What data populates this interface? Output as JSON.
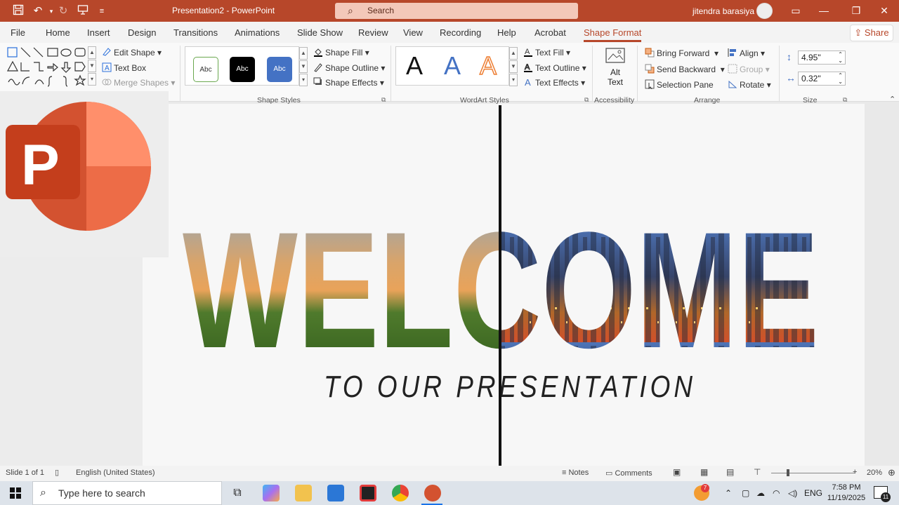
{
  "titlebar": {
    "doc_title": "Presentation2  -  PowerPoint",
    "search_placeholder": "Search",
    "user_name": "jitendra barasiya",
    "qat": {
      "save_icon": "save-icon",
      "undo_icon": "undo-icon",
      "redo_icon": "redo-icon",
      "present_icon": "present-icon",
      "customize_icon": "customize-qat-icon"
    }
  },
  "tabs": [
    "File",
    "Home",
    "Insert",
    "Design",
    "Transitions",
    "Animations",
    "Slide Show",
    "Review",
    "View",
    "Recording",
    "Help",
    "Acrobat",
    "Shape Format"
  ],
  "active_tab": "Shape Format",
  "share_label": "Share",
  "ribbon": {
    "insert_shapes": {
      "edit_shape": "Edit Shape",
      "text_box": "Text Box",
      "merge_shapes": "Merge Shapes",
      "label": "Insert Shapes"
    },
    "shape_styles": {
      "preset_text": "Abc",
      "shape_fill": "Shape Fill",
      "shape_outline": "Shape Outline",
      "shape_effects": "Shape Effects",
      "label": "Shape Styles"
    },
    "wordart_styles": {
      "glyph": "A",
      "text_fill": "Text Fill",
      "text_outline": "Text Outline",
      "text_effects": "Text Effects",
      "label": "WordArt Styles"
    },
    "accessibility": {
      "alt_text_1": "Alt",
      "alt_text_2": "Text",
      "label": "Accessibility"
    },
    "arrange": {
      "bring_forward": "Bring Forward",
      "send_backward": "Send Backward",
      "selection_pane": "Selection Pane",
      "align": "Align",
      "group": "Group",
      "rotate": "Rotate",
      "label": "Arrange"
    },
    "size": {
      "height": "4.95\"",
      "width": "0.32\"",
      "label": "Size"
    }
  },
  "slide": {
    "heading": "WELCOME",
    "subheading": "TO OUR PRESENTATION"
  },
  "logo_letter": "P",
  "statusbar": {
    "slide_info": "Slide 1 of 1",
    "language": "English (United States)",
    "notes": "Notes",
    "comments": "Comments",
    "zoom": "20%"
  },
  "taskbar": {
    "search_placeholder": "Type here to search",
    "notification_badge": "7",
    "language": "ENG",
    "time": "7:58 PM",
    "date": "11/19/2025",
    "notifications_count": "11"
  },
  "colors": {
    "accent": "#b7472a",
    "ribbon_bg": "#f9f9f9"
  }
}
